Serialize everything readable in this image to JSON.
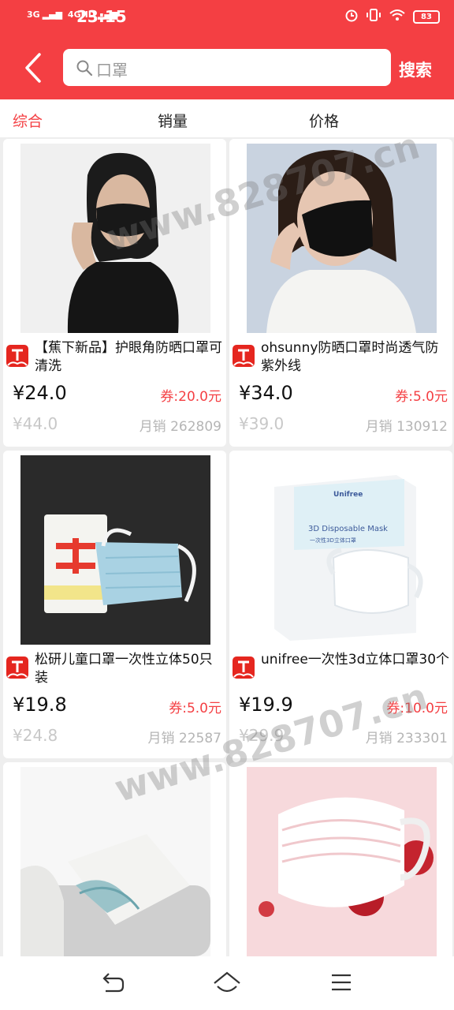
{
  "status_bar": {
    "network_1": "3G",
    "network_2": "4GHD",
    "time": "23:15",
    "battery": "83"
  },
  "search": {
    "query": "口罩",
    "button_label": "搜索"
  },
  "tabs": [
    {
      "label": "综合",
      "active": true
    },
    {
      "label": "销量",
      "active": false
    },
    {
      "label": "价格",
      "active": false
    }
  ],
  "products": [
    {
      "title": "【蕉下新品】护眼角防晒口罩可清洗",
      "price": "¥24.0",
      "coupon": "券:20.0元",
      "original_price": "¥44.0",
      "monthly_sales": "月销 262809"
    },
    {
      "title": "ohsunny防晒口罩时尚透气防紫外线",
      "price": "¥34.0",
      "coupon": "券:5.0元",
      "original_price": "¥39.0",
      "monthly_sales": "月销 130912"
    },
    {
      "title": "松研儿童口罩一次性立体50只装",
      "price": "¥19.8",
      "coupon": "券:5.0元",
      "original_price": "¥24.8",
      "monthly_sales": "月销 22587"
    },
    {
      "title": "unifree一次性3d立体口罩30个",
      "price": "¥19.9",
      "coupon": "券:10.0元",
      "original_price": "¥29.9",
      "monthly_sales": "月销 233301"
    },
    {
      "title": "",
      "price": "",
      "coupon": "",
      "original_price": "",
      "monthly_sales": ""
    },
    {
      "title": "",
      "price": "",
      "coupon": "",
      "original_price": "",
      "monthly_sales": ""
    }
  ],
  "image_text": {
    "box_brand": "Unifree",
    "box_product": "3D Disposable Mask",
    "box_product_cn": "一次性3D立体口罩"
  },
  "watermark": "www.828707.cn",
  "colors": {
    "brand": "#f43f43",
    "coupon": "#f43f43",
    "muted": "#c8c8c8"
  },
  "icons": {
    "back": "chevron-left-icon",
    "search": "search-icon",
    "shop": "tmall-shop-icon",
    "nav_back": "return-icon",
    "nav_home": "home-icon",
    "nav_menu": "menu-icon"
  }
}
